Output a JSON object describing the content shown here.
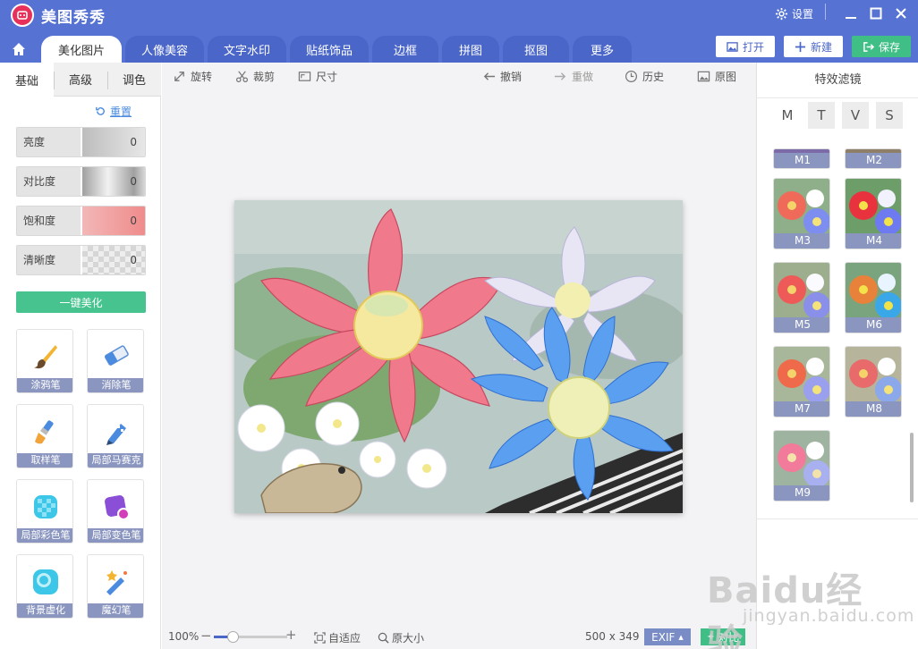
{
  "app": {
    "title": "美图秀秀",
    "settings_label": "设置"
  },
  "tabs": [
    "美化图片",
    "人像美容",
    "文字水印",
    "贴纸饰品",
    "边框",
    "拼图",
    "抠图",
    "更多"
  ],
  "actions": {
    "open": "打开",
    "new": "新建",
    "save": "保存"
  },
  "left_panel": {
    "subtabs": [
      "基础",
      "高级",
      "调色"
    ],
    "reset_label": "重置",
    "sliders": [
      {
        "label": "亮度",
        "value": "0"
      },
      {
        "label": "对比度",
        "value": "0"
      },
      {
        "label": "饱和度",
        "value": "0"
      },
      {
        "label": "清晰度",
        "value": "0"
      }
    ],
    "beautify_label": "一键美化",
    "tools": [
      "涂鸦笔",
      "消除笔",
      "取样笔",
      "局部马赛克",
      "局部彩色笔",
      "局部变色笔",
      "背景虚化",
      "魔幻笔"
    ]
  },
  "toolbar": {
    "rotate": "旋转",
    "crop": "裁剪",
    "size": "尺寸",
    "undo": "撤销",
    "redo": "重做",
    "history": "历史",
    "original": "原图"
  },
  "bottom": {
    "zoom": "100%",
    "zoom_level": 0.25,
    "fit": "自适应",
    "original_size": "原大小",
    "dimensions": "500 x 349",
    "exif": "EXIF",
    "compare": "对比"
  },
  "right_panel": {
    "title": "特效滤镜",
    "categories": [
      "M",
      "T",
      "V",
      "S"
    ],
    "filters": [
      "M1",
      "M2",
      "M3",
      "M4",
      "M5",
      "M6",
      "M7",
      "M8",
      "M9"
    ]
  },
  "watermark": {
    "line1": "Baidu经验",
    "line2": "jingyan.baidu.com"
  },
  "colors": {
    "titlebar": "#5673d4",
    "accent_green": "#3fbf86",
    "label_band": "#8a96bf"
  }
}
